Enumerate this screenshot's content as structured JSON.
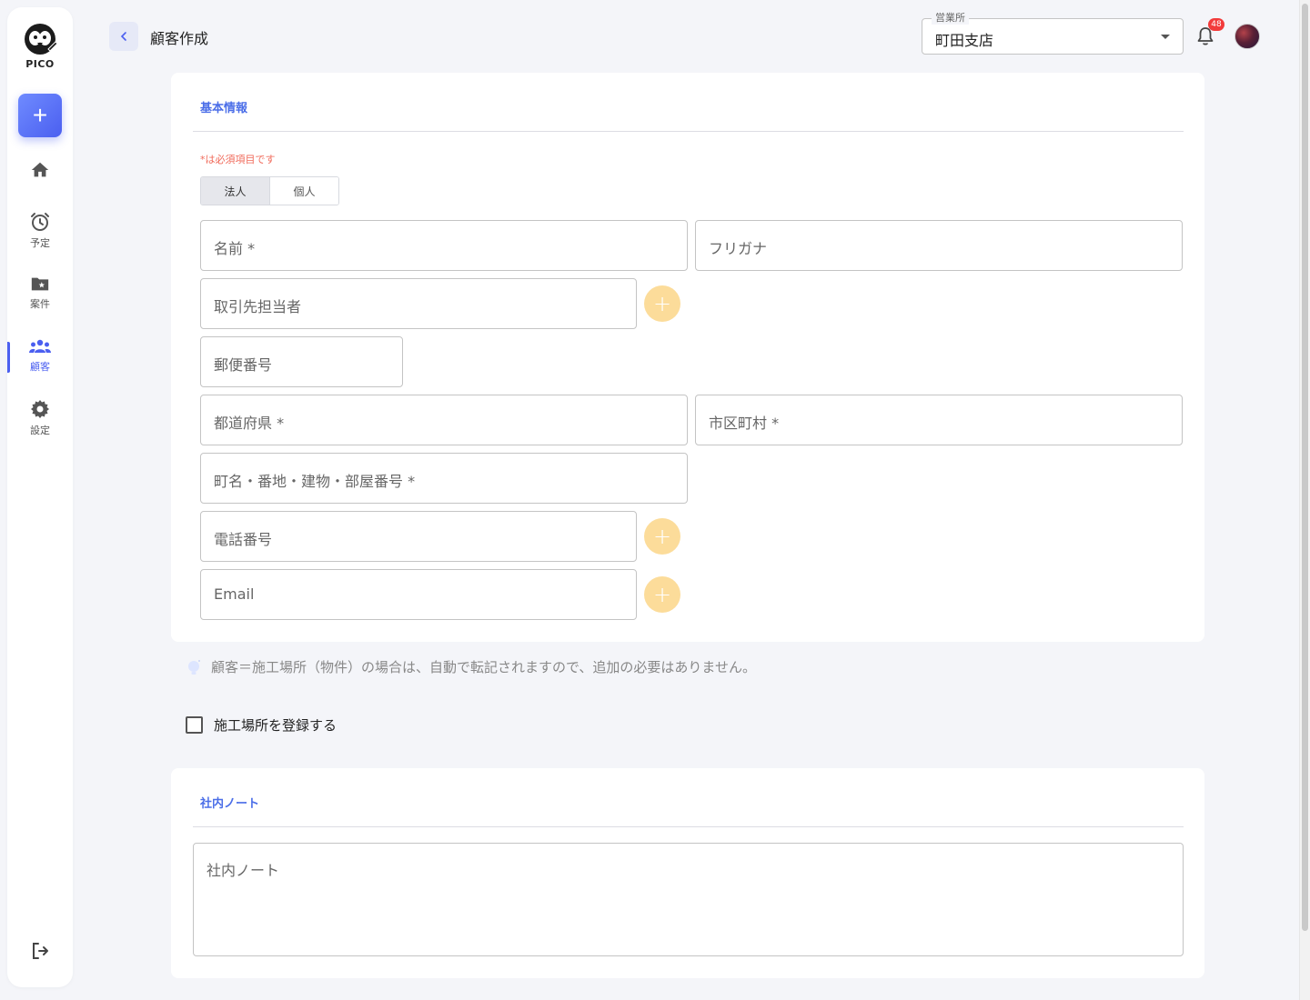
{
  "app": {
    "logo_text": "PICO",
    "brand_color": "#4b5ff0"
  },
  "sidebar": {
    "add_button": "+",
    "items": [
      {
        "key": "home",
        "label": "",
        "icon": "home-icon"
      },
      {
        "key": "schedule",
        "label": "予定",
        "icon": "alarm-clock-icon"
      },
      {
        "key": "projects",
        "label": "案件",
        "icon": "folder-star-icon"
      },
      {
        "key": "customers",
        "label": "顧客",
        "icon": "people-group-icon",
        "active": true
      },
      {
        "key": "settings",
        "label": "設定",
        "icon": "gear-icon"
      }
    ],
    "logout_icon": "logout-icon"
  },
  "header": {
    "title": "顧客作成",
    "office": {
      "legend": "営業所",
      "value": "町田支店"
    },
    "notifications": {
      "count": "48"
    }
  },
  "basic_info": {
    "section_title": "基本情報",
    "required_note": "*は必須項目です",
    "type_toggle": {
      "options": [
        "法人",
        "個人"
      ],
      "selected": "法人"
    },
    "fields": {
      "name": "名前 *",
      "furigana": "フリガナ",
      "contact_person": "取引先担当者",
      "postal_code": "郵便番号",
      "prefecture": "都道府県 *",
      "city": "市区町村 *",
      "address": "町名・番地・建物・部屋番号 *",
      "phone": "電話番号",
      "email": "Email"
    },
    "add_more_label": "+"
  },
  "tip": {
    "text": "顧客＝施工場所（物件）の場合は、自動で転記されますので、追加の必要はありません。"
  },
  "register_site": {
    "label": "施工場所を登録する",
    "checked": false
  },
  "internal_note": {
    "section_title": "社内ノート",
    "placeholder": "社内ノート"
  }
}
